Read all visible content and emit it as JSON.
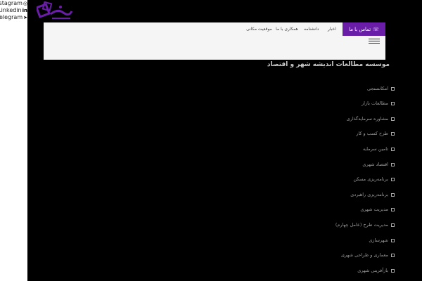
{
  "social": {
    "instagram": {
      "label": "Instagram",
      "icon": "instagram-icon",
      "glyph": "◎"
    },
    "linkedin": {
      "label": "Linkedin",
      "icon": "linkedin-icon",
      "glyph": "in"
    },
    "telegram": {
      "label": "Telegram",
      "icon": "telegram-icon",
      "glyph": "➤"
    }
  },
  "header": {
    "contact_label": "تماس با ما",
    "nav": {
      "news": "اخبار",
      "encyclopedia": "دانشنامه",
      "cooperate": "همکاری با ما",
      "location": "موقعیت مکانی"
    }
  },
  "section_title": "موسسه مطالعات اندیشه شهر و اقتصاد",
  "menu": [
    "امکانسنجی",
    "مطالعات بازار",
    "مشاوره سرمایه‌گذاری",
    "طرح کسب و کار",
    "تامین سرمایه",
    "اقتصاد شهری",
    "برنامه‌ریزی مسکن",
    "برنامه‌ریزی راهبردی",
    "مدیریت شهری",
    "مدیریت طرح (عامل چهارم)",
    "شهرسازی",
    "معماری و طراحی شهری",
    "بازآفرینی شهری"
  ],
  "colors": {
    "accent": "#6a1ea8",
    "background": "#000000",
    "header": "#f5f5f5"
  }
}
